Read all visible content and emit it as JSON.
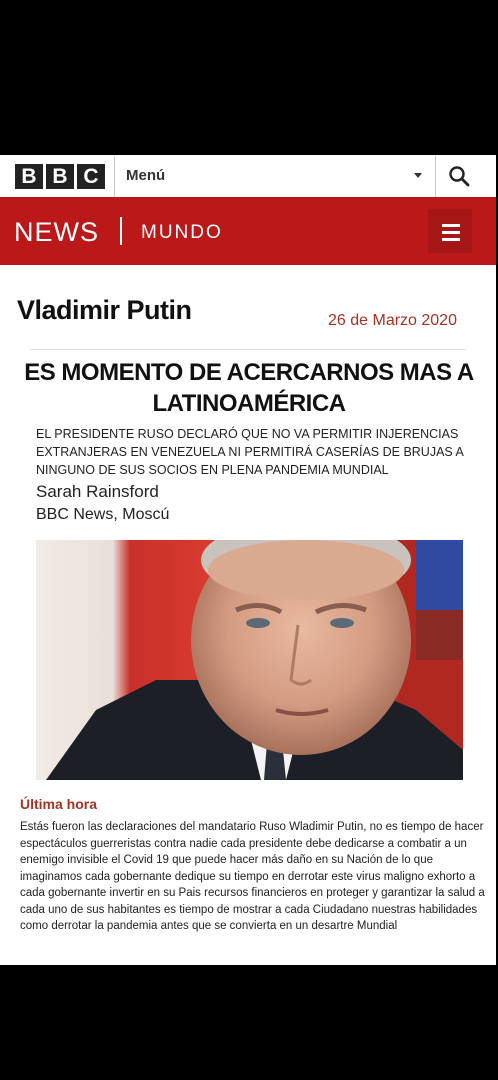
{
  "header": {
    "logo_letters": [
      "B",
      "B",
      "C"
    ],
    "menu_label": "Menú",
    "news_label": "NEWS",
    "section_label": "MUNDO"
  },
  "article": {
    "author_title": "Vladimir Putin",
    "date": "26 de Marzo 2020",
    "headline": "ES MOMENTO DE ACERCARNOS MAS A LATINOAMÉRICA",
    "subheadline": "EL PRESIDENTE RUSO DECLARÓ QUE NO VA PERMITIR INJERENCIAS EXTRANJERAS EN VENEZUELA NI PERMITIRÁ CASERÍAS DE BRUJAS A NINGUNO DE SUS SOCIOS EN PLENA PANDEMIA MUNDIAL",
    "reporter": "Sarah Rainsford",
    "office": "BBC News, Moscú",
    "section_heading": "Última hora",
    "body": "Estás fueron las declaraciones del mandatario Ruso Wladimir Putin, no es tiempo de hacer espectáculos guerreristas contra nadie cada presidente debe dedicarse a combatir a un enemigo invisible el Covid 19 que puede hacer más daño en su Nación de lo que imaginamos cada gobernante dedique su tiempo en derrotar este virus maligno exhorto a cada gobernante invertir en su Pais recursos financieros en proteger y garantizar la salud a cada uno de sus habitantes es tiempo de mostrar a cada Ciudadano nuestras habilidades como derrotar la pandemia antes que se convierta en un desartre Mundial"
  },
  "icons": {
    "search": "search-icon",
    "menu": "hamburger-menu-icon",
    "dropdown": "chevron-down-icon"
  },
  "colors": {
    "brand_red": "#bb1919",
    "date_red": "#a63226",
    "logo_dark": "#222222"
  }
}
